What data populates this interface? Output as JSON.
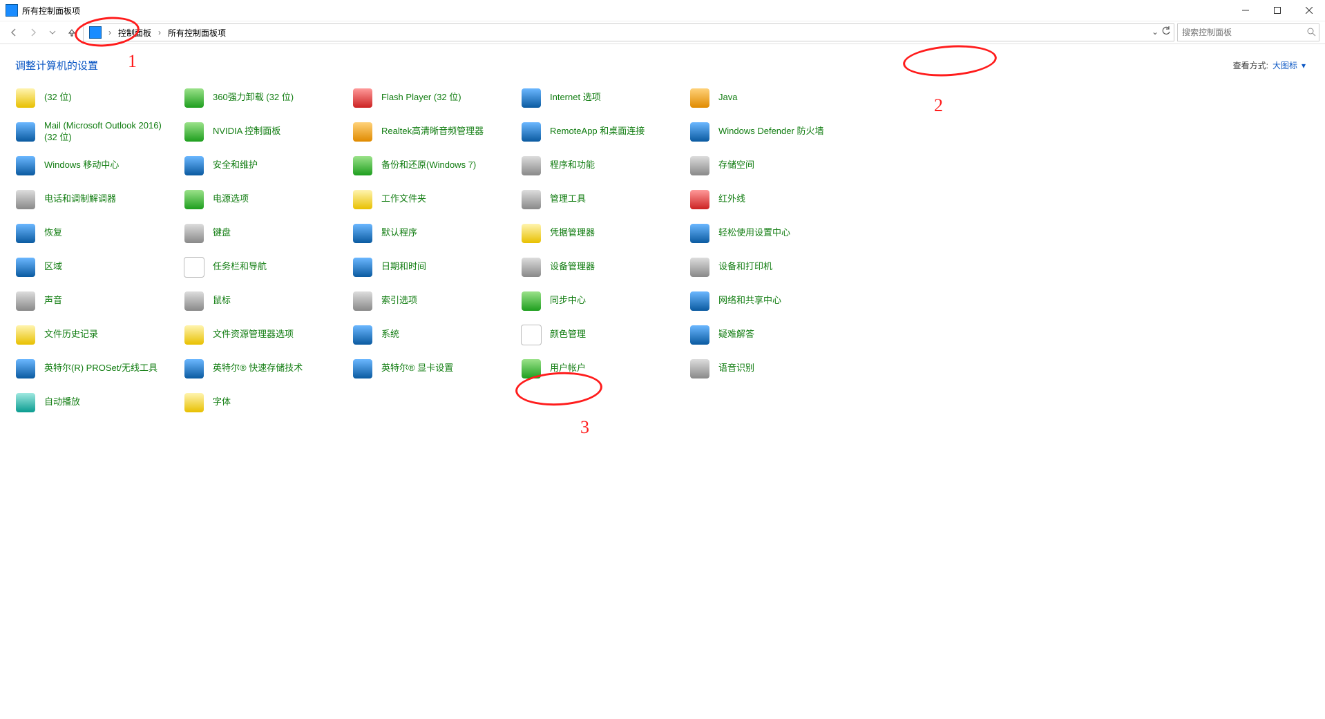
{
  "window": {
    "title": "所有控制面板项"
  },
  "breadcrumb": {
    "root": "控制面板",
    "current": "所有控制面板项"
  },
  "search": {
    "placeholder": "搜索控制面板"
  },
  "header": {
    "title": "调整计算机的设置",
    "view_label": "查看方式:",
    "view_value": "大图标"
  },
  "annotations": {
    "a1": "1",
    "a2": "2",
    "a3": "3"
  },
  "items": [
    {
      "label": "(32 位)",
      "icon": "generic-32bit",
      "hue": "c-yellow"
    },
    {
      "label": "360强力卸载 (32 位)",
      "icon": "360-uninstall",
      "hue": "c-green"
    },
    {
      "label": "Flash Player (32 位)",
      "icon": "flash",
      "hue": "c-red"
    },
    {
      "label": "Internet 选项",
      "icon": "internet-options",
      "hue": "c-blue"
    },
    {
      "label": "Java",
      "icon": "java",
      "hue": "c-orange"
    },
    {
      "label": "Mail (Microsoft Outlook 2016) (32 位)",
      "icon": "mail",
      "hue": "c-blue"
    },
    {
      "label": "NVIDIA 控制面板",
      "icon": "nvidia",
      "hue": "c-green"
    },
    {
      "label": "Realtek高清晰音频管理器",
      "icon": "realtek-audio",
      "hue": "c-orange"
    },
    {
      "label": "RemoteApp 和桌面连接",
      "icon": "remoteapp",
      "hue": "c-blue"
    },
    {
      "label": "Windows Defender 防火墙",
      "icon": "defender-firewall",
      "hue": "c-blue"
    },
    {
      "label": "Windows 移动中心",
      "icon": "mobility-center",
      "hue": "c-blue"
    },
    {
      "label": "安全和维护",
      "icon": "security-maintenance",
      "hue": "c-blue"
    },
    {
      "label": "备份和还原(Windows 7)",
      "icon": "backup-restore",
      "hue": "c-green"
    },
    {
      "label": "程序和功能",
      "icon": "programs-features",
      "hue": "c-grey"
    },
    {
      "label": "存储空间",
      "icon": "storage-spaces",
      "hue": "c-grey"
    },
    {
      "label": "电话和调制解调器",
      "icon": "phone-modem",
      "hue": "c-grey"
    },
    {
      "label": "电源选项",
      "icon": "power-options",
      "hue": "c-green"
    },
    {
      "label": "工作文件夹",
      "icon": "work-folders",
      "hue": "c-yellow"
    },
    {
      "label": "管理工具",
      "icon": "admin-tools",
      "hue": "c-grey"
    },
    {
      "label": "红外线",
      "icon": "infrared",
      "hue": "c-red"
    },
    {
      "label": "恢复",
      "icon": "recovery",
      "hue": "c-blue"
    },
    {
      "label": "键盘",
      "icon": "keyboard",
      "hue": "c-grey"
    },
    {
      "label": "默认程序",
      "icon": "default-programs",
      "hue": "c-blue"
    },
    {
      "label": "凭据管理器",
      "icon": "credential-manager",
      "hue": "c-yellow"
    },
    {
      "label": "轻松使用设置中心",
      "icon": "ease-of-access",
      "hue": "c-blue"
    },
    {
      "label": "区域",
      "icon": "region",
      "hue": "c-blue"
    },
    {
      "label": "任务栏和导航",
      "icon": "taskbar-nav",
      "hue": "c-white"
    },
    {
      "label": "日期和时间",
      "icon": "date-time",
      "hue": "c-blue"
    },
    {
      "label": "设备管理器",
      "icon": "device-manager",
      "hue": "c-grey"
    },
    {
      "label": "设备和打印机",
      "icon": "devices-printers",
      "hue": "c-grey"
    },
    {
      "label": "声音",
      "icon": "sound",
      "hue": "c-grey"
    },
    {
      "label": "鼠标",
      "icon": "mouse",
      "hue": "c-grey"
    },
    {
      "label": "索引选项",
      "icon": "indexing-options",
      "hue": "c-grey"
    },
    {
      "label": "同步中心",
      "icon": "sync-center",
      "hue": "c-green"
    },
    {
      "label": "网络和共享中心",
      "icon": "network-sharing",
      "hue": "c-blue"
    },
    {
      "label": "文件历史记录",
      "icon": "file-history",
      "hue": "c-yellow"
    },
    {
      "label": "文件资源管理器选项",
      "icon": "explorer-options",
      "hue": "c-yellow"
    },
    {
      "label": "系统",
      "icon": "system",
      "hue": "c-blue"
    },
    {
      "label": "颜色管理",
      "icon": "color-management",
      "hue": "c-white"
    },
    {
      "label": "疑难解答",
      "icon": "troubleshooting",
      "hue": "c-blue"
    },
    {
      "label": "英特尔(R) PROSet/无线工具",
      "icon": "intel-proset",
      "hue": "c-blue"
    },
    {
      "label": "英特尔® 快速存储技术",
      "icon": "intel-rst",
      "hue": "c-blue"
    },
    {
      "label": "英特尔® 显卡设置",
      "icon": "intel-graphics",
      "hue": "c-blue"
    },
    {
      "label": "用户帐户",
      "icon": "user-accounts",
      "hue": "c-green"
    },
    {
      "label": "语音识别",
      "icon": "speech-recognition",
      "hue": "c-grey"
    },
    {
      "label": "自动播放",
      "icon": "autoplay",
      "hue": "c-teal"
    },
    {
      "label": "字体",
      "icon": "fonts",
      "hue": "c-yellow"
    }
  ]
}
